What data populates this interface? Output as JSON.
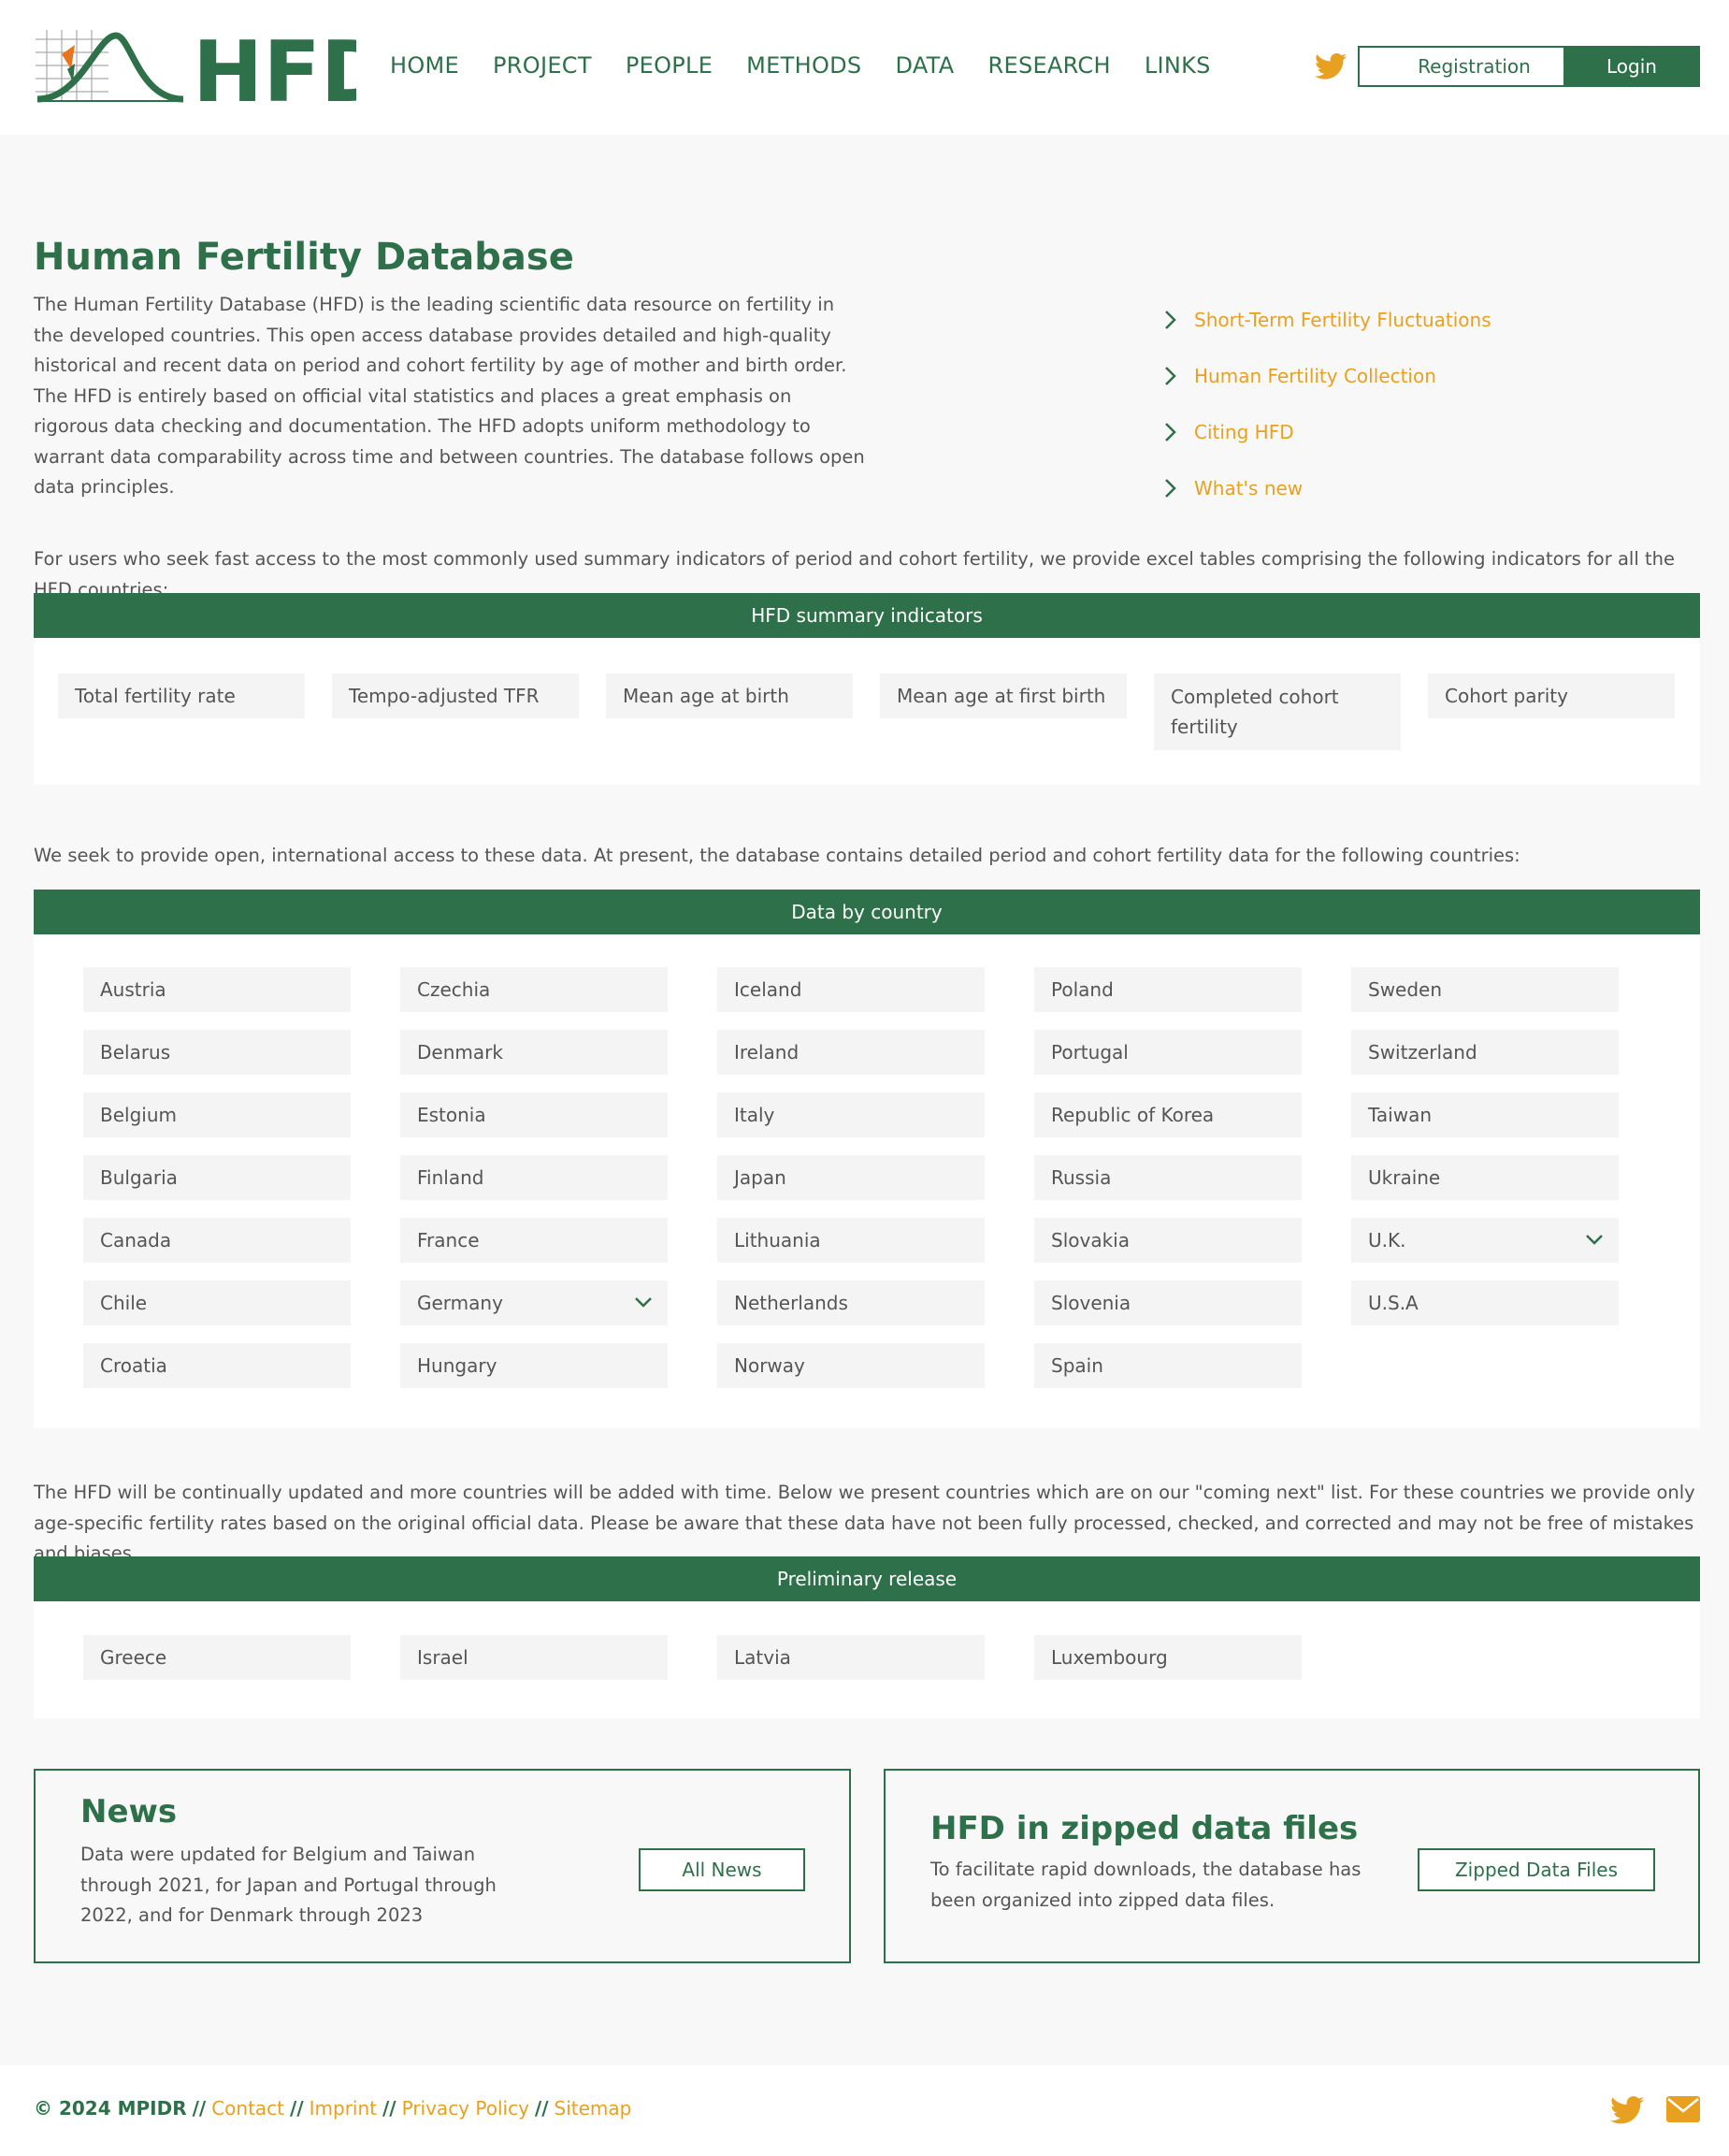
{
  "header": {
    "logo_text": "HFD",
    "nav": [
      "HOME",
      "PROJECT",
      "PEOPLE",
      "METHODS",
      "DATA",
      "RESEARCH",
      "LINKS"
    ],
    "registration": "Registration",
    "login": "Login",
    "icon": "twitter-icon"
  },
  "main": {
    "title": "Human Fertility Database",
    "intro": "The Human Fertility Database (HFD) is the leading scientific data resource on fertility in the developed countries. This open access database provides detailed and high-quality historical and recent data on period and cohort fertility by age of mother and birth order. The HFD is entirely based on official vital statistics and places a great emphasis on rigorous data checking and documentation. The HFD adopts uniform methodology to warrant data comparability across time and between countries. The database follows open data principles.",
    "side_links": [
      "Short-Term Fertility Fluctuations",
      "Human Fertility Collection",
      "Citing HFD",
      "What's new"
    ],
    "summary_intro": "For users who seek fast access to the most commonly used summary indicators of period and cohort fertility, we provide excel tables comprising the following indicators for all the HFD countries:",
    "summary_title": "HFD summary indicators",
    "summary_items": [
      "Total fertility rate",
      "Tempo-adjusted TFR",
      "Mean age at birth",
      "Mean age at first birth",
      "Completed cohort fertility",
      "Cohort parity"
    ],
    "countries_intro": "We seek to provide open, international access to these data. At present, the database contains detailed period and cohort fertility data for the following countries:",
    "countries_title": "Data by country",
    "countries": [
      [
        "Austria",
        "Belarus",
        "Belgium",
        "Bulgaria",
        "Canada",
        "Chile",
        "Croatia"
      ],
      [
        "Czechia",
        "Denmark",
        "Estonia",
        "Finland",
        "France",
        "Germany",
        "Hungary"
      ],
      [
        "Iceland",
        "Ireland",
        "Italy",
        "Japan",
        "Lithuania",
        "Netherlands",
        "Norway"
      ],
      [
        "Poland",
        "Portugal",
        "Republic of Korea",
        "Russia",
        "Slovakia",
        "Slovenia",
        "Spain"
      ],
      [
        "Sweden",
        "Switzerland",
        "Taiwan",
        "Ukraine",
        "U.K.",
        "U.S.A"
      ]
    ],
    "prelim_intro": "The HFD will be continually updated and more countries will be added with time. Below we present countries which are on our \"coming next\" list. For these countries we provide only age-specific fertility rates based on the original official data. Please be aware that these data have not been fully processed, checked, and corrected and may not be free of mistakes and biases.",
    "prelim_title": "Preliminary release",
    "prelim_countries": [
      "Greece",
      "Israel",
      "Latvia",
      "Luxembourg"
    ]
  },
  "news": {
    "title": "News",
    "text": "Data were updated for Belgium and Taiwan through 2021, for Japan and Portugal through 2022, and for Denmark through 2023",
    "button": "All News"
  },
  "zipped": {
    "title": "HFD in zipped data files",
    "text": "To facilitate rapid downloads, the database has been organized into zipped data files.",
    "button": "Zipped Data Files"
  },
  "footer": {
    "copyright": "© 2024 MPIDR",
    "links": [
      "Contact",
      "Imprint",
      "Privacy Policy",
      "Sitemap"
    ],
    "icons": [
      "twitter-icon",
      "mail-icon"
    ]
  },
  "colors": {
    "brand_green": "#2e7049",
    "accent_orange": "#e8a020"
  }
}
